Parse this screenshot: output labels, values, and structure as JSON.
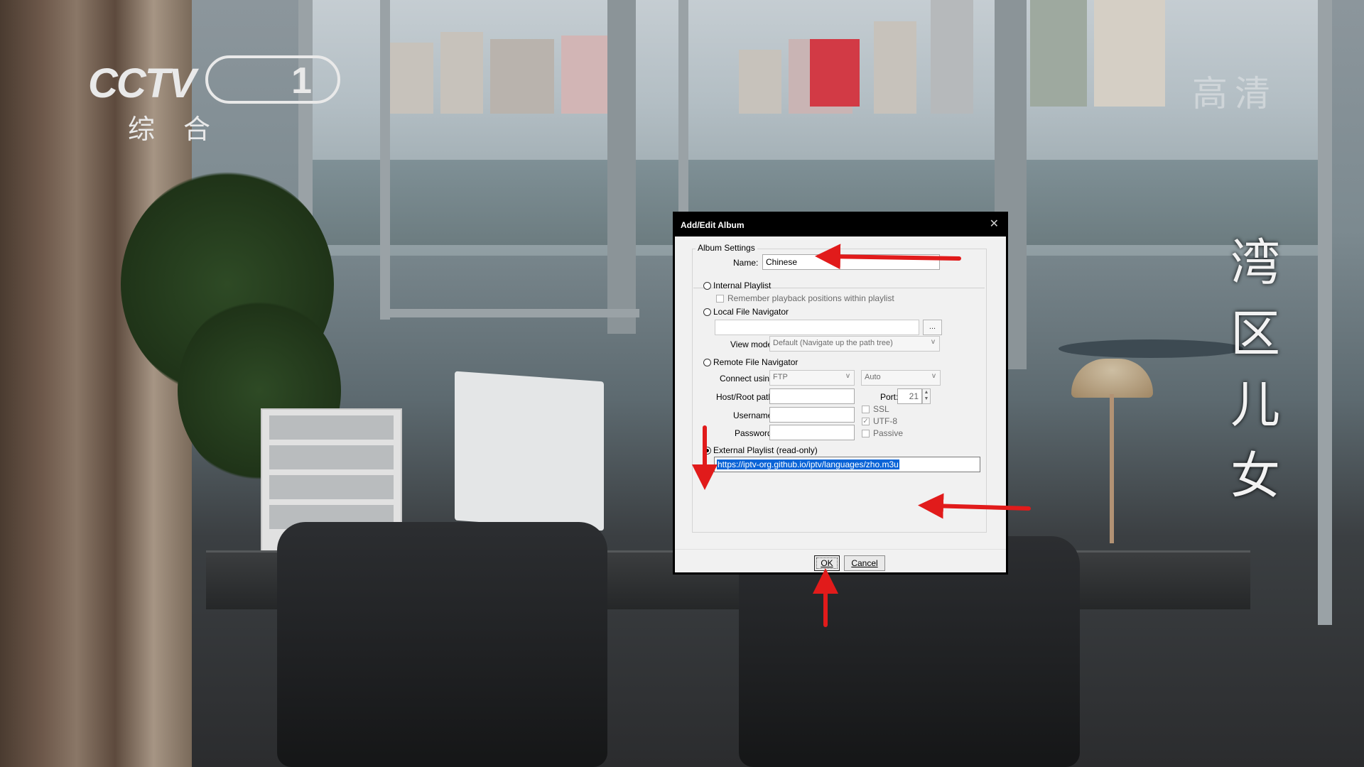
{
  "overlay": {
    "channel_logo": "CCTV",
    "channel_number": "1",
    "channel_subtitle": "综合",
    "hd_badge": "高清",
    "show_title": [
      "湾",
      "区",
      "儿",
      "女"
    ]
  },
  "dialog": {
    "title": "Add/Edit Album",
    "close_glyph": "✕",
    "group_label": "Album Settings",
    "name_label": "Name:",
    "name_value": "Chinese",
    "internal_playlist_label": "Internal Playlist",
    "remember_positions_label": "Remember playback positions within playlist",
    "local_file_navigator_label": "Local File Navigator",
    "local_path_value": "",
    "browse_label": "...",
    "view_mode_label": "View mode:",
    "view_mode_value": "Default (Navigate up the path tree)",
    "remote_file_navigator_label": "Remote File Navigator",
    "connect_using_label": "Connect using:",
    "connect_protocol_value": "FTP",
    "connect_mode_value": "Auto",
    "host_root_label": "Host/Root path:",
    "host_root_value": "",
    "port_label": "Port:",
    "port_value": "21",
    "username_label": "Username:",
    "username_value": "",
    "password_label": "Password:",
    "password_value": "",
    "ssl_label": "SSL",
    "utf8_label": "UTF-8",
    "passive_label": "Passive",
    "external_playlist_label": "External Playlist (read-only)",
    "external_playlist_url": "https://iptv-org.github.io/iptv/languages/zho.m3u",
    "selected_source": "External Playlist (read-only)",
    "ok_label": "OK",
    "cancel_label": "Cancel"
  },
  "annotations": {
    "arrow_color": "#e11b1b"
  }
}
